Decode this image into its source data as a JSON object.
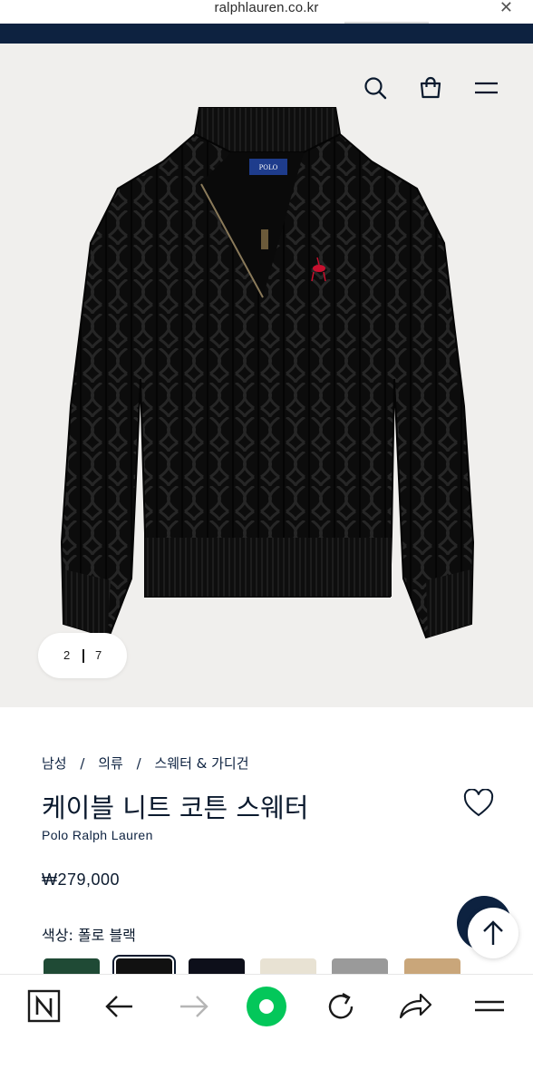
{
  "browser": {
    "url": "ralphlauren.co.kr",
    "close_icon": "close-icon"
  },
  "header": {
    "icons": [
      "search-icon",
      "shopping-bag-icon",
      "hamburger-menu-icon"
    ]
  },
  "gallery": {
    "current": "2",
    "total": "7"
  },
  "breadcrumb": {
    "items": [
      "남성",
      "의류",
      "스웨터 & 가디건"
    ],
    "separator": "/"
  },
  "product": {
    "title": "케이블 니트 코튼 스웨터",
    "brand": "Polo Ralph Lauren",
    "price": "₩279,000",
    "color_label": "색상: 폴로 블랙"
  },
  "swatches": [
    {
      "name": "green",
      "color": "#1f4a35",
      "selected": false
    },
    {
      "name": "polo-black",
      "color": "#111111",
      "selected": true
    },
    {
      "name": "navy",
      "color": "#0d0f1a",
      "selected": false
    },
    {
      "name": "cream",
      "color": "#e8e2d3",
      "selected": false
    },
    {
      "name": "grey",
      "color": "#9a9a9a",
      "selected": false
    },
    {
      "name": "camel",
      "color": "#c9a67a",
      "selected": false
    }
  ],
  "colors": {
    "navy": "#0d2240",
    "hero_bg": "#f0efed",
    "naver_green": "#03c75a"
  },
  "toolbar": {
    "icons": [
      "naver-n-icon",
      "back-arrow-icon",
      "forward-arrow-icon",
      "naver-green-dot-icon",
      "refresh-icon",
      "share-icon",
      "menu-icon"
    ]
  }
}
